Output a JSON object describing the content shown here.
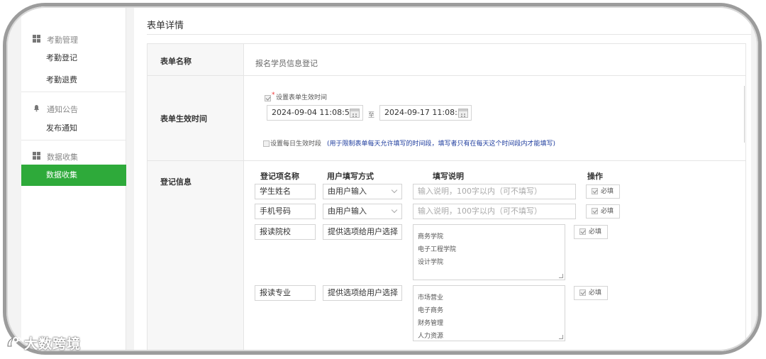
{
  "sidebar": {
    "groups": [
      {
        "label": "考勤管理",
        "icon": "grid-icon",
        "items": [
          "考勤登记",
          "考勤退费"
        ]
      },
      {
        "label": "通知公告",
        "icon": "bell-icon",
        "items": [
          "发布通知"
        ]
      },
      {
        "label": "数据收集",
        "icon": "grid-icon",
        "items": [
          "数据收集"
        ]
      }
    ],
    "active_item": "数据收集",
    "accent": "#2eaa3a"
  },
  "page": {
    "title": "表单详情"
  },
  "form": {
    "name_label": "表单名称",
    "name_value": "报名学员信息登记",
    "time_label": "表单生效时间",
    "time_checkbox_label": "设置表单生效时间",
    "time_required_mark": "*",
    "start": "2024-09-04 11:08:57",
    "to": "至",
    "end": "2024-09-17 11:08:58",
    "daily_label": "设置每日生效时段",
    "daily_hint": "(用于限制表单每天允许填写的时间段，填写者只有在每天这个时间段内才能填写)",
    "reg_label": "登记信息",
    "columns": [
      "登记项名称",
      "用户填写方式",
      "填写说明",
      "操作"
    ],
    "rows": [
      {
        "name": "学生姓名",
        "mode": "由用户输入",
        "desc_placeholder": "输入说明，100字以内（可不填写）",
        "required": "必填"
      },
      {
        "name": "手机号码",
        "mode": "由用户输入",
        "desc_placeholder": "输入说明，100字以内（可不填写）",
        "required": "必填"
      },
      {
        "name": "报读院校",
        "mode": "提供选项给用户选择",
        "options": [
          "商务学院",
          "电子工程学院",
          "设计学院"
        ],
        "required": "必填"
      },
      {
        "name": "报读专业",
        "mode": "提供选项给用户选择",
        "options": [
          "市场营业",
          "电子商务",
          "财务管理",
          "人力资源"
        ],
        "required": "必填"
      }
    ]
  },
  "watermark": "大数跨境"
}
